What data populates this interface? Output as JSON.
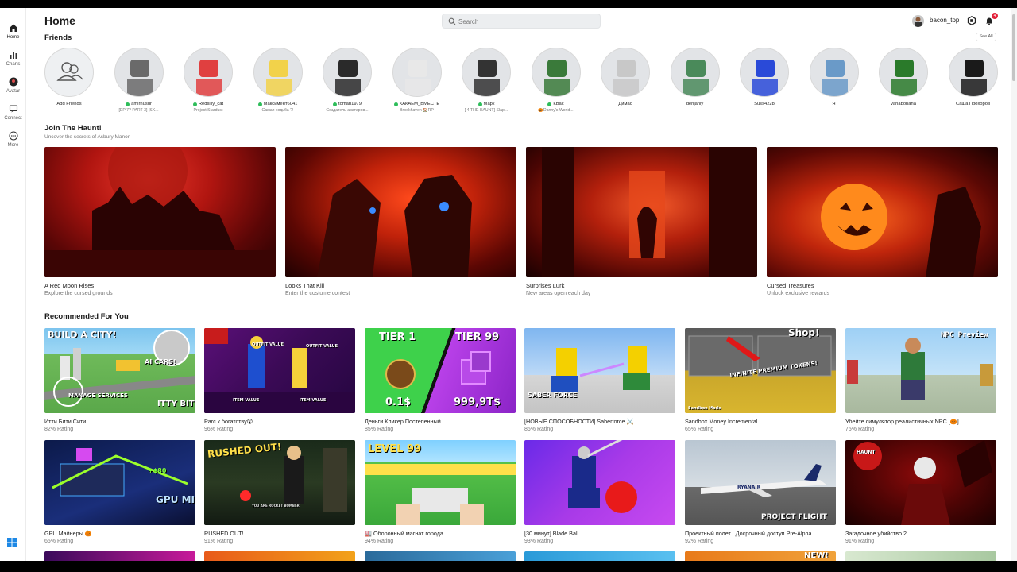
{
  "sidebar": {
    "items": [
      {
        "label": "Home",
        "icon": "home-icon"
      },
      {
        "label": "Charts",
        "icon": "charts-icon"
      },
      {
        "label": "Avatar",
        "icon": "avatar-icon"
      },
      {
        "label": "Connect",
        "icon": "connect-icon"
      },
      {
        "label": "More",
        "icon": "more-icon"
      }
    ]
  },
  "header": {
    "title": "Home",
    "search_placeholder": "Search",
    "username": "bacon_top",
    "notification_count": "4"
  },
  "friends": {
    "title": "Friends",
    "see_all": "See All",
    "add_label": "Add Friends",
    "list": [
      {
        "name": "amirnusur",
        "status": "[EP 7? PART 3] [SK...",
        "online": true
      },
      {
        "name": "Redsilly_cat",
        "status": "Project Stardust",
        "online": true
      },
      {
        "name": "Максимент6041",
        "status": "Самая ходьба ?!",
        "online": true
      },
      {
        "name": "tomari1979",
        "status": "Создатель аватаров...",
        "online": true
      },
      {
        "name": "КАКАЕМ_ВМЕСТЕ",
        "status": "Brookhaven 🏠RP",
        "online": true
      },
      {
        "name": "Марк",
        "status": "[ 4 THE HAUNT] Slap...",
        "online": true
      },
      {
        "name": "КВас",
        "status": "🎃Danny's World...",
        "online": true
      },
      {
        "name": "Димас",
        "status": "",
        "online": false
      },
      {
        "name": "denjaniy",
        "status": "",
        "online": false
      },
      {
        "name": "Suss4228",
        "status": "",
        "online": false
      },
      {
        "name": "Я",
        "status": "",
        "online": false
      },
      {
        "name": "vanabonana",
        "status": "",
        "online": false
      },
      {
        "name": "Саша Прохоров",
        "status": "",
        "online": false
      }
    ]
  },
  "haunt": {
    "title": "Join The Haunt!",
    "subtitle": "Uncover the secrets of Asbury Manor",
    "cards": [
      {
        "title": "A Red Moon Rises",
        "subtitle": "Explore the cursed grounds"
      },
      {
        "title": "Looks That Kill",
        "subtitle": "Enter the costume contest"
      },
      {
        "title": "Surprises Lurk",
        "subtitle": "New areas open each day"
      },
      {
        "title": "Cursed Treasures",
        "subtitle": "Unlock exclusive rewards"
      }
    ]
  },
  "recommended": {
    "title": "Recommended For You",
    "games": [
      {
        "title": "Итти Бити Сити",
        "rating": "82% Rating",
        "thumb_text": [
          "BUILD A CITY!",
          "AI CARS!",
          "MANAGE SERVICES",
          "ITTY BITTY CITY"
        ]
      },
      {
        "title": "Parc к богатству😲",
        "rating": "96% Rating",
        "thumb_text": [
          "OUTFIT VALUE",
          "OUTFIT VALUE",
          "ITEM VALUE",
          "ITEM VALUE"
        ]
      },
      {
        "title": "Деньги Кликер Постепенный",
        "rating": "85% Rating",
        "thumb_text": [
          "TIER 1",
          "TIER 99",
          "0.1$",
          "999,9T$"
        ]
      },
      {
        "title": "[НОВЫЕ СПОСОБНОСТИ] Saberforce ⚔️",
        "rating": "86% Rating",
        "thumb_text": [
          "SABER FORCE"
        ]
      },
      {
        "title": "Sandbox Money Incremental",
        "rating": "65% Rating",
        "thumb_text": [
          "Shop!",
          "INFINITE PREMIUM TOKENS!",
          "Sandbox Mode"
        ]
      },
      {
        "title": "Убейте симулятор реалистичных NPC [🎃]",
        "rating": "75% Rating",
        "thumb_text": [
          "NPC Preview"
        ]
      },
      {
        "title": "GPU Майнеры 🎃",
        "rating": "65% Rating",
        "thumb_text": [
          "GPU MINERS",
          "+$80"
        ]
      },
      {
        "title": "RUSHED OUT!",
        "rating": "91% Rating",
        "thumb_text": [
          "RUSHED OUT!",
          "YOU ARE ROCKET BOMBER"
        ]
      },
      {
        "title": "🏭 Оборонный магнат города",
        "rating": "94% Rating",
        "thumb_text": [
          "LEVEL 99"
        ]
      },
      {
        "title": "[30 минут] Blade Ball",
        "rating": "93% Rating",
        "thumb_text": []
      },
      {
        "title": "Проектный полет | Досрочный доступ Pre-Alpha",
        "rating": "92% Rating",
        "thumb_text": [
          "RYANAIR",
          "PROJECT FLIGHT"
        ]
      },
      {
        "title": "Загадочное убийство 2",
        "rating": "91% Rating",
        "thumb_text": [
          "HAUNT"
        ]
      }
    ],
    "partial_row_badge": "NEW!"
  },
  "colors": {
    "online": "#2ebd5a",
    "badge": "#e3223a",
    "text_muted": "#777777"
  }
}
